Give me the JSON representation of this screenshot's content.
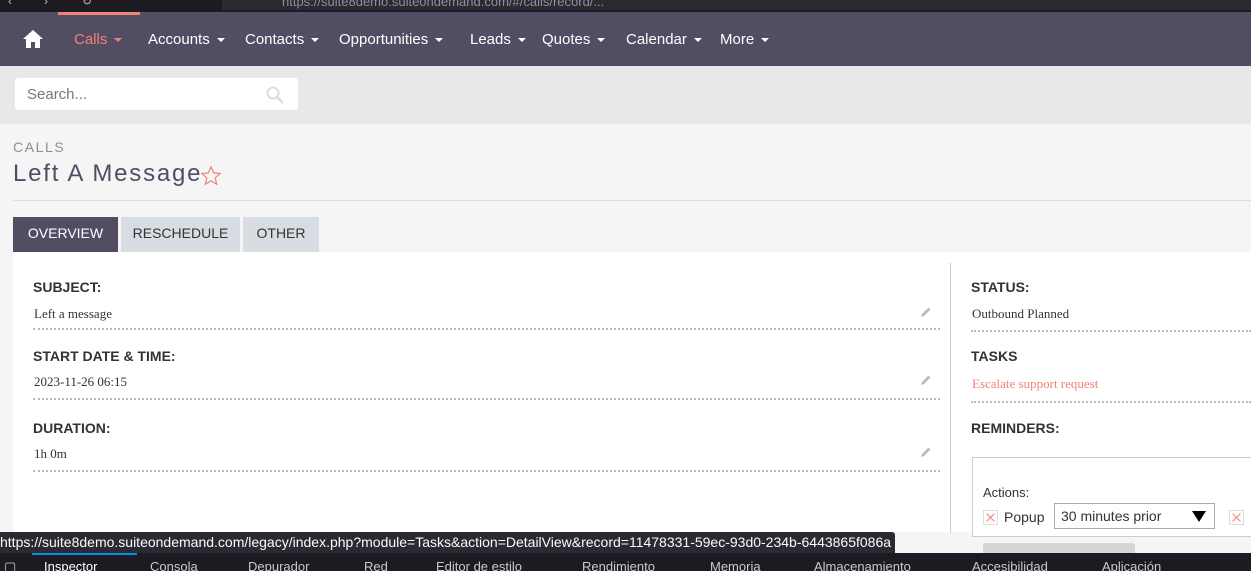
{
  "browser": {
    "url_fragment": "https://suite8demo.suiteondemand.com/#/calls/record/..."
  },
  "nav": {
    "items": [
      {
        "label": "Calls"
      },
      {
        "label": "Accounts"
      },
      {
        "label": "Contacts"
      },
      {
        "label": "Opportunities"
      },
      {
        "label": "Leads"
      },
      {
        "label": "Quotes"
      },
      {
        "label": "Calendar"
      },
      {
        "label": "More"
      }
    ]
  },
  "search": {
    "placeholder": "Search..."
  },
  "record": {
    "module": "CALLS",
    "title": "Left A Message"
  },
  "tabs": [
    {
      "label": "OVERVIEW"
    },
    {
      "label": "RESCHEDULE"
    },
    {
      "label": "OTHER"
    }
  ],
  "fields": {
    "subject": {
      "label": "SUBJECT:",
      "value": "Left a message"
    },
    "start": {
      "label": "START DATE & TIME:",
      "value": "2023-11-26 06:15"
    },
    "duration": {
      "label": "DURATION:",
      "value": "1h 0m"
    },
    "status": {
      "label": "STATUS:",
      "value": "Outbound Planned"
    },
    "tasks": {
      "label": "TASKS",
      "value": "Escalate support request"
    },
    "reminders": {
      "label": "REMINDERS:"
    }
  },
  "reminder": {
    "actions_label": "Actions:",
    "popup_label": "Popup",
    "timing": "30 minutes prior"
  },
  "statusbar": {
    "link": "https://suite8demo.suiteondemand.com/legacy/index.php?module=Tasks&action=DetailView&record=11478331-59ec-93d0-234b-6443865f086a"
  },
  "devtools": {
    "tabs": [
      "Inspector",
      "Consola",
      "Depurador",
      "Red",
      "Editor de estilo",
      "Rendimiento",
      "Memoria",
      "Almacenamiento",
      "Accesibilidad",
      "Aplicación"
    ]
  },
  "colors": {
    "nav_bg": "#534d64",
    "accent": "#f08377"
  }
}
